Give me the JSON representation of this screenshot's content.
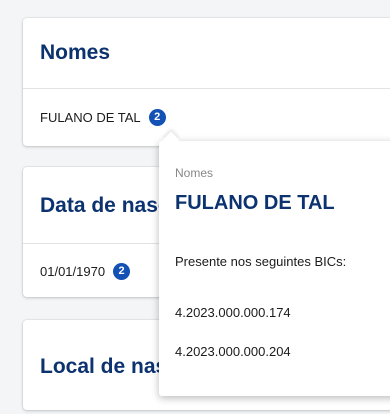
{
  "cards": {
    "nomes": {
      "title": "Nomes",
      "value": "FULANO DE TAL",
      "count": "2"
    },
    "data_nascimento": {
      "title": "Data de nasc",
      "value": "01/01/1970",
      "count": "2"
    },
    "local_nascimento": {
      "title": "Local de nas"
    }
  },
  "popover": {
    "label": "Nomes",
    "title": "FULANO DE TAL",
    "subtitle": "Presente nos seguintes BICs:",
    "bics": [
      "4.2023.000.000.174",
      "4.2023.000.000.204"
    ]
  },
  "colors": {
    "title": "#0c326f",
    "badge": "#1351b4",
    "background": "#f4f5f7"
  }
}
